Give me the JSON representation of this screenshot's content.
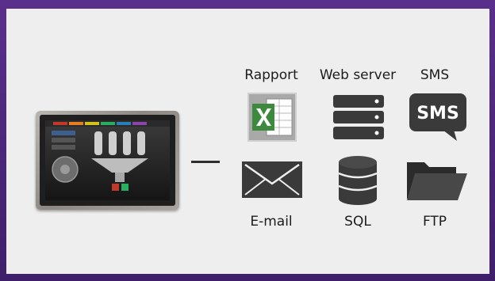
{
  "diagram": {
    "outputs": [
      {
        "id": "rapport",
        "label": "Rapport",
        "icon": "excel-spreadsheet-icon"
      },
      {
        "id": "webserver",
        "label": "Web server",
        "icon": "server-rack-icon"
      },
      {
        "id": "sms",
        "label": "SMS",
        "icon": "sms-speech-bubble-icon",
        "icon_text": "SMS"
      },
      {
        "id": "email",
        "label": "E-mail",
        "icon": "envelope-icon"
      },
      {
        "id": "sql",
        "label": "SQL",
        "icon": "database-cylinder-icon"
      },
      {
        "id": "ftp",
        "label": "FTP",
        "icon": "folder-icon"
      }
    ],
    "device": {
      "icon": "hmi-touch-panel"
    },
    "colors": {
      "border": "#4b2a7b",
      "background": "#eeeeee",
      "icon_dark": "#3a3a3a",
      "excel_green": "#3d8a3e"
    }
  }
}
